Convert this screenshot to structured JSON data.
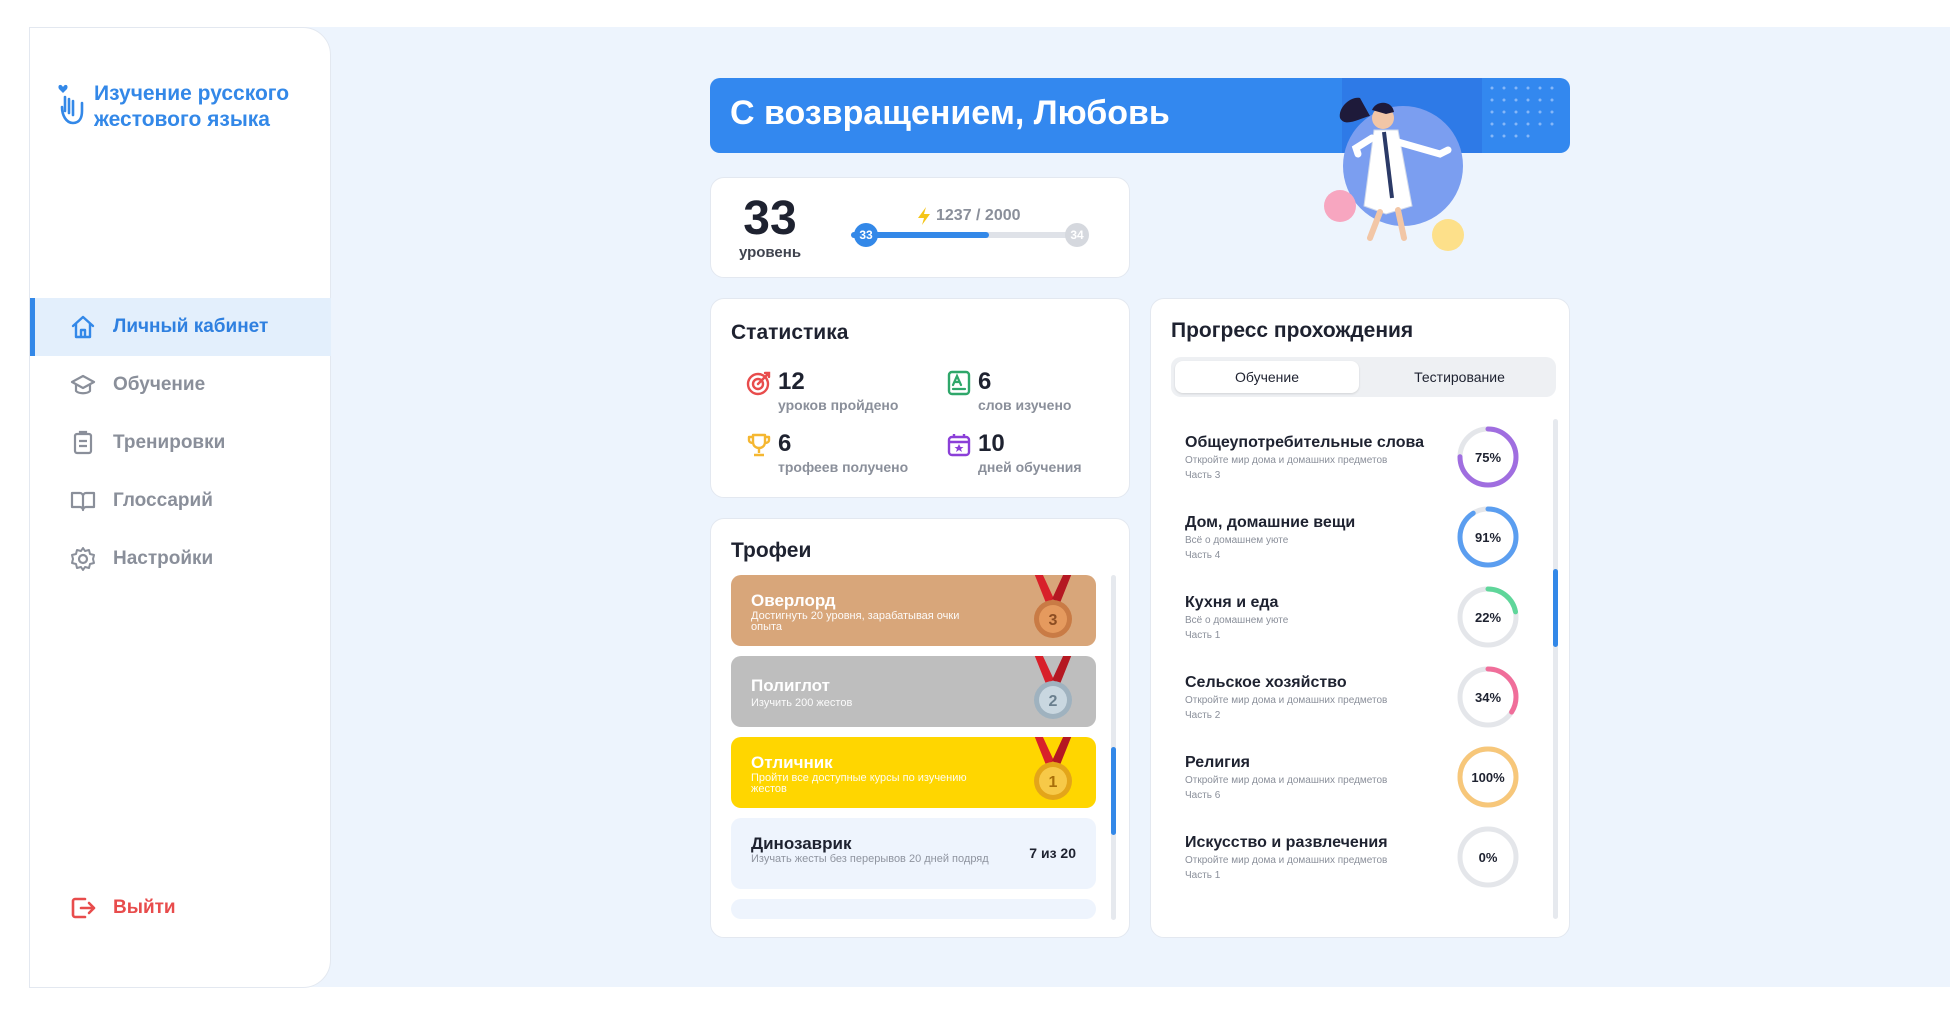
{
  "app": {
    "title": "Изучение русского жестового языка"
  },
  "sidebar": {
    "items": [
      {
        "label": "Личный кабинет",
        "icon": "home-icon",
        "active": true
      },
      {
        "label": "Обучение",
        "icon": "graduation-cap-icon",
        "active": false
      },
      {
        "label": "Тренировки",
        "icon": "clipboard-icon",
        "active": false
      },
      {
        "label": "Глоссарий",
        "icon": "book-icon",
        "active": false
      },
      {
        "label": "Настройки",
        "icon": "gear-icon",
        "active": false
      }
    ],
    "logout_label": "Выйти"
  },
  "banner": {
    "title": "С возвращением, Любовь"
  },
  "level": {
    "value": "33",
    "label": "уровень",
    "xp": "1237 / 2000",
    "xp_fraction": 0.618,
    "current_badge": "33",
    "next_badge": "34"
  },
  "stats": {
    "title": "Статистика",
    "items": [
      {
        "value": "12",
        "label": "уроков пройдено",
        "icon": "target-icon",
        "color": "#e84c4c"
      },
      {
        "value": "6",
        "label": "слов изучено",
        "icon": "vocabulary-icon",
        "color": "#2fa76a"
      },
      {
        "value": "6",
        "label": "трофеев получено",
        "icon": "trophy-icon",
        "color": "#f5b731"
      },
      {
        "value": "10",
        "label": "дней обучения",
        "icon": "calendar-icon",
        "color": "#8b3fd8"
      }
    ]
  },
  "trophies": {
    "title": "Трофеи",
    "items": [
      {
        "name": "Оверлорд",
        "desc": "Достигнуть 20 уровня, зарабатывая очки опыта",
        "color": "#d8a67a",
        "medal": "3"
      },
      {
        "name": "Полиглот",
        "desc": "Изучить 200 жестов",
        "color": "#bebebe",
        "medal": "2"
      },
      {
        "name": "Отличник",
        "desc": "Пройти все доступные курсы по изучению жестов",
        "color": "#ffd600",
        "medal": "1"
      },
      {
        "name": "Динозаврик",
        "desc": "Изучать жесты без перерывов 20 дней подряд",
        "count": "7 из 20"
      }
    ]
  },
  "progress": {
    "title": "Прогресс прохождения",
    "tabs": [
      "Обучение",
      "Тестирование"
    ],
    "courses": [
      {
        "name": "Общеупотребительные слова",
        "desc": "Откройте мир дома и домашних предметов",
        "part": "Часть 3",
        "percent": 75,
        "label": "75%",
        "color": "#a06ee0"
      },
      {
        "name": "Дом, домашние вещи",
        "desc": "Всё о домашнем уюте",
        "part": "Часть 4",
        "percent": 91,
        "label": "91%",
        "color": "#5b9ef0"
      },
      {
        "name": "Кухня и еда",
        "desc": "Всё о домашнем уюте",
        "part": "Часть 1",
        "percent": 22,
        "label": "22%",
        "color": "#5fd69a"
      },
      {
        "name": "Сельское хозяйство",
        "desc": "Откройте мир дома и домашних предметов",
        "part": "Часть 2",
        "percent": 34,
        "label": "34%",
        "color": "#f06e9a"
      },
      {
        "name": "Религия",
        "desc": "Откройте мир дома и домашних предметов",
        "part": "Часть 6",
        "percent": 100,
        "label": "100%",
        "color": "#f7c77a"
      },
      {
        "name": "Искусство и развлечения",
        "desc": "Откройте мир дома и домашних предметов",
        "part": "Часть 1",
        "percent": 0,
        "label": "0%",
        "color": "#5b9ef0"
      }
    ]
  }
}
